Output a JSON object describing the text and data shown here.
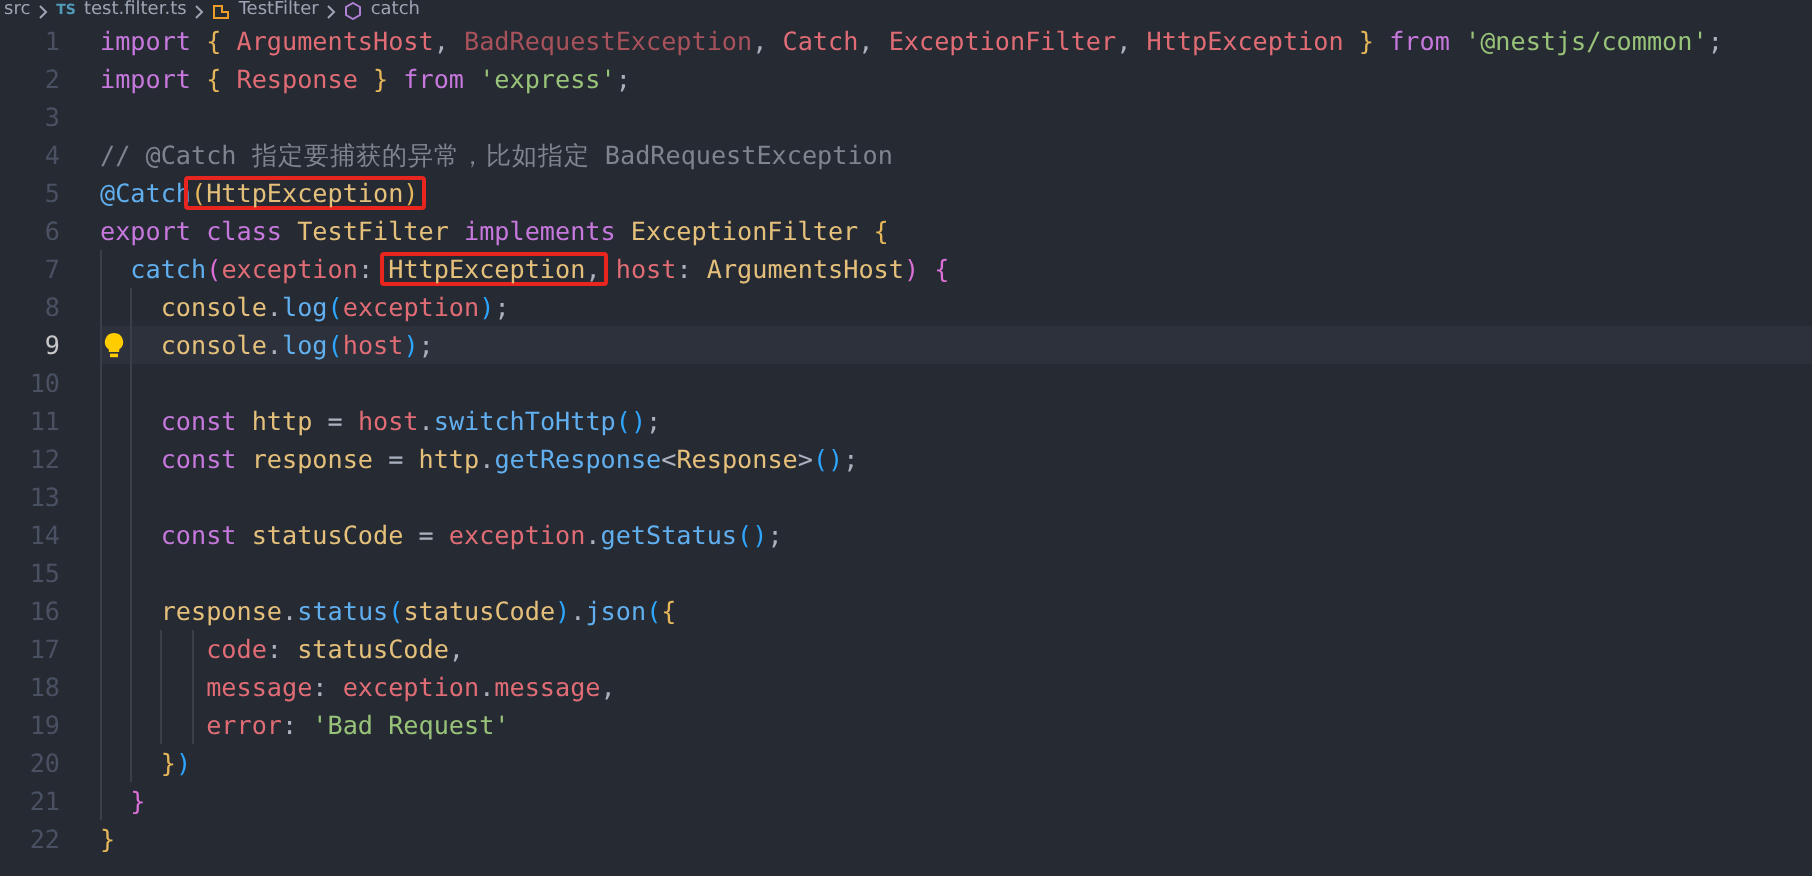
{
  "breadcrumb": [
    {
      "kind": "folder",
      "label": "src"
    },
    {
      "kind": "file",
      "badge": "TS",
      "label": "test.filter.ts"
    },
    {
      "kind": "class",
      "label": "TestFilter"
    },
    {
      "kind": "method",
      "label": "catch"
    }
  ],
  "editor": {
    "lines": [
      {
        "number": "1",
        "current": false,
        "hint": false,
        "tokens": [
          {
            "text": "import ",
            "kind": "kw"
          },
          {
            "text": "{ ",
            "kind": "b1"
          },
          {
            "text": "ArgumentsHost",
            "kind": "ident"
          },
          {
            "text": ", ",
            "kind": "plain"
          },
          {
            "text": "BadRequestException",
            "kind": "unused"
          },
          {
            "text": ", ",
            "kind": "plain"
          },
          {
            "text": "Catch",
            "kind": "ident"
          },
          {
            "text": ", ",
            "kind": "plain"
          },
          {
            "text": "ExceptionFilter",
            "kind": "ident"
          },
          {
            "text": ", ",
            "kind": "plain"
          },
          {
            "text": "HttpException",
            "kind": "ident"
          },
          {
            "text": " }",
            "kind": "b1"
          },
          {
            "text": " from ",
            "kind": "kw"
          },
          {
            "text": "'@nestjs/common'",
            "kind": "str"
          },
          {
            "text": ";",
            "kind": "plain"
          }
        ]
      },
      {
        "number": "2",
        "current": false,
        "hint": false,
        "tokens": [
          {
            "text": "import ",
            "kind": "kw"
          },
          {
            "text": "{ ",
            "kind": "b1"
          },
          {
            "text": "Response",
            "kind": "ident"
          },
          {
            "text": " }",
            "kind": "b1"
          },
          {
            "text": " from ",
            "kind": "kw"
          },
          {
            "text": "'express'",
            "kind": "str"
          },
          {
            "text": ";",
            "kind": "plain"
          }
        ]
      },
      {
        "number": "3",
        "current": false,
        "hint": false
      },
      {
        "number": "4",
        "current": false,
        "hint": false,
        "tokens": [
          {
            "text": "// @Catch 指定要捕获的异常，比如指定 BadRequestException",
            "kind": "comment"
          }
        ]
      },
      {
        "number": "5",
        "current": false,
        "hint": false,
        "tokens": [
          {
            "text": "@Catch",
            "kind": "fn"
          },
          {
            "text": "(",
            "kind": "b1",
            "boxed": true
          },
          {
            "text": "HttpException",
            "kind": "type",
            "boxed": true
          },
          {
            "text": ")",
            "kind": "b1",
            "boxed": true
          }
        ]
      },
      {
        "number": "6",
        "current": false,
        "hint": false,
        "tokens": [
          {
            "text": "export ",
            "kind": "kw"
          },
          {
            "text": "class ",
            "kind": "kw"
          },
          {
            "text": "TestFilter",
            "kind": "type"
          },
          {
            "text": " implements ",
            "kind": "kw"
          },
          {
            "text": "ExceptionFilter",
            "kind": "type"
          },
          {
            "text": " {",
            "kind": "b1"
          }
        ]
      },
      {
        "number": "7",
        "current": false,
        "hint": false,
        "tokens": [
          {
            "text": "  catch",
            "kind": "fn"
          },
          {
            "text": "(",
            "kind": "b2"
          },
          {
            "text": "exception",
            "kind": "ident"
          },
          {
            "text": ": ",
            "kind": "plain"
          },
          {
            "text": "HttpException",
            "kind": "type",
            "boxed": true
          },
          {
            "text": ",",
            "kind": "plain",
            "boxed": true
          },
          {
            "text": " host",
            "kind": "ident"
          },
          {
            "text": ": ",
            "kind": "plain"
          },
          {
            "text": "ArgumentsHost",
            "kind": "type"
          },
          {
            "text": ")",
            "kind": "b2"
          },
          {
            "text": " {",
            "kind": "b2"
          }
        ]
      },
      {
        "number": "8",
        "current": false,
        "hint": false,
        "tokens": [
          {
            "text": "    console",
            "kind": "type"
          },
          {
            "text": ".",
            "kind": "plain"
          },
          {
            "text": "log",
            "kind": "fn"
          },
          {
            "text": "(",
            "kind": "b3"
          },
          {
            "text": "exception",
            "kind": "ident"
          },
          {
            "text": ")",
            "kind": "b3"
          },
          {
            "text": ";",
            "kind": "plain"
          }
        ]
      },
      {
        "number": "9",
        "current": true,
        "hint": true,
        "tokens": [
          {
            "text": "    console",
            "kind": "type"
          },
          {
            "text": ".",
            "kind": "plain"
          },
          {
            "text": "log",
            "kind": "fn"
          },
          {
            "text": "(",
            "kind": "b3"
          },
          {
            "text": "host",
            "kind": "ident"
          },
          {
            "text": ")",
            "kind": "b3"
          },
          {
            "text": ";",
            "kind": "plain"
          }
        ]
      },
      {
        "number": "10",
        "current": false,
        "hint": false
      },
      {
        "number": "11",
        "current": false,
        "hint": false,
        "tokens": [
          {
            "text": "    const ",
            "kind": "kw"
          },
          {
            "text": "http",
            "kind": "type"
          },
          {
            "text": " = ",
            "kind": "plain"
          },
          {
            "text": "host",
            "kind": "ident"
          },
          {
            "text": ".",
            "kind": "plain"
          },
          {
            "text": "switchToHttp",
            "kind": "fn"
          },
          {
            "text": "()",
            "kind": "b3"
          },
          {
            "text": ";",
            "kind": "plain"
          }
        ]
      },
      {
        "number": "12",
        "current": false,
        "hint": false,
        "tokens": [
          {
            "text": "    const ",
            "kind": "kw"
          },
          {
            "text": "response",
            "kind": "type"
          },
          {
            "text": " = ",
            "kind": "plain"
          },
          {
            "text": "http",
            "kind": "type"
          },
          {
            "text": ".",
            "kind": "plain"
          },
          {
            "text": "getResponse",
            "kind": "fn"
          },
          {
            "text": "<",
            "kind": "plain"
          },
          {
            "text": "Response",
            "kind": "type"
          },
          {
            "text": ">",
            "kind": "plain"
          },
          {
            "text": "()",
            "kind": "b3"
          },
          {
            "text": ";",
            "kind": "plain"
          }
        ]
      },
      {
        "number": "13",
        "current": false,
        "hint": false
      },
      {
        "number": "14",
        "current": false,
        "hint": false,
        "tokens": [
          {
            "text": "    const ",
            "kind": "kw"
          },
          {
            "text": "statusCode",
            "kind": "type"
          },
          {
            "text": " = ",
            "kind": "plain"
          },
          {
            "text": "exception",
            "kind": "ident"
          },
          {
            "text": ".",
            "kind": "plain"
          },
          {
            "text": "getStatus",
            "kind": "fn"
          },
          {
            "text": "()",
            "kind": "b3"
          },
          {
            "text": ";",
            "kind": "plain"
          }
        ]
      },
      {
        "number": "15",
        "current": false,
        "hint": false
      },
      {
        "number": "16",
        "current": false,
        "hint": false,
        "tokens": [
          {
            "text": "    response",
            "kind": "type"
          },
          {
            "text": ".",
            "kind": "plain"
          },
          {
            "text": "status",
            "kind": "fn"
          },
          {
            "text": "(",
            "kind": "b3"
          },
          {
            "text": "statusCode",
            "kind": "type"
          },
          {
            "text": ")",
            "kind": "b3"
          },
          {
            "text": ".",
            "kind": "plain"
          },
          {
            "text": "json",
            "kind": "fn"
          },
          {
            "text": "(",
            "kind": "b3"
          },
          {
            "text": "{",
            "kind": "b1"
          }
        ]
      },
      {
        "number": "17",
        "current": false,
        "hint": false,
        "tokens": [
          {
            "text": "       code",
            "kind": "ident"
          },
          {
            "text": ": ",
            "kind": "plain"
          },
          {
            "text": "statusCode",
            "kind": "type"
          },
          {
            "text": ",",
            "kind": "plain"
          }
        ]
      },
      {
        "number": "18",
        "current": false,
        "hint": false,
        "tokens": [
          {
            "text": "       message",
            "kind": "ident"
          },
          {
            "text": ": ",
            "kind": "plain"
          },
          {
            "text": "exception",
            "kind": "ident"
          },
          {
            "text": ".",
            "kind": "plain"
          },
          {
            "text": "message",
            "kind": "ident"
          },
          {
            "text": ",",
            "kind": "plain"
          }
        ]
      },
      {
        "number": "19",
        "current": false,
        "hint": false,
        "tokens": [
          {
            "text": "       error",
            "kind": "ident"
          },
          {
            "text": ": ",
            "kind": "plain"
          },
          {
            "text": "'Bad Request'",
            "kind": "str"
          }
        ]
      },
      {
        "number": "20",
        "current": false,
        "hint": false,
        "tokens": [
          {
            "text": "    }",
            "kind": "b1"
          },
          {
            "text": ")",
            "kind": "b3"
          }
        ]
      },
      {
        "number": "21",
        "current": false,
        "hint": false,
        "tokens": [
          {
            "text": "  }",
            "kind": "b2"
          }
        ]
      },
      {
        "number": "22",
        "current": false,
        "hint": false,
        "tokens": [
          {
            "text": "}",
            "kind": "b1"
          }
        ]
      }
    ]
  }
}
